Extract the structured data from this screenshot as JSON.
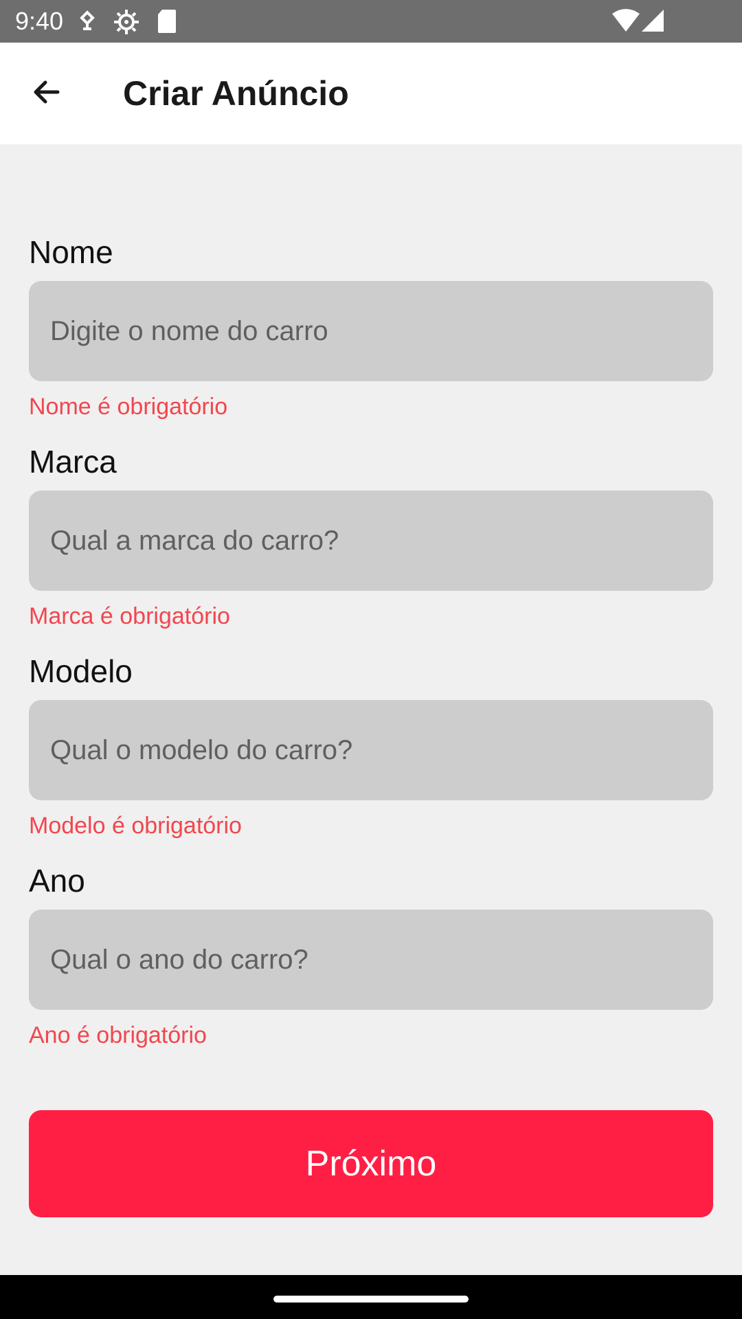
{
  "status_bar": {
    "time": "9:40",
    "icons": [
      "usb-debug-icon",
      "settings-gear-icon",
      "sd-card-icon",
      "wifi-icon",
      "cellular-signal-icon"
    ]
  },
  "app_bar": {
    "title": "Criar Anúncio",
    "back_icon": "arrow-back-icon"
  },
  "form": {
    "fields": [
      {
        "label": "Nome",
        "placeholder": "Digite o nome do carro",
        "value": "",
        "error": "Nome é obrigatório"
      },
      {
        "label": "Marca",
        "placeholder": "Qual a marca do carro?",
        "value": "",
        "error": "Marca é obrigatório"
      },
      {
        "label": "Modelo",
        "placeholder": "Qual o modelo do carro?",
        "value": "",
        "error": "Modelo é obrigatório"
      },
      {
        "label": "Ano",
        "placeholder": "Qual o ano do carro?",
        "value": "",
        "error": "Ano é obrigatório"
      }
    ],
    "submit_label": "Próximo"
  },
  "colors": {
    "accent": "#ff1f45",
    "error": "#f2464e",
    "input_background": "#cdcdcd",
    "page_background": "#f0f0f0"
  }
}
